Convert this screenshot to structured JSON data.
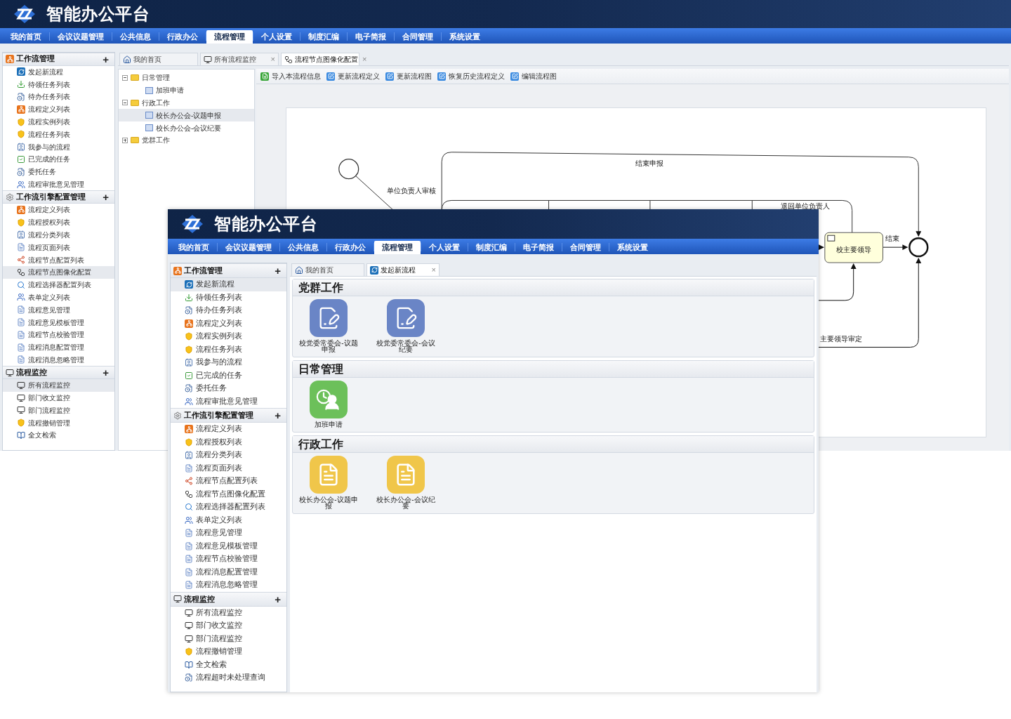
{
  "back_window": {
    "app_title": "智能办公平台",
    "nav": [
      {
        "label": "我的首页",
        "selected": false
      },
      {
        "label": "会议议题管理",
        "selected": false
      },
      {
        "label": "公共信息",
        "selected": false
      },
      {
        "label": "行政办公",
        "selected": false
      },
      {
        "label": "流程管理",
        "selected": true
      },
      {
        "label": "个人设置",
        "selected": false
      },
      {
        "label": "制度汇编",
        "selected": false
      },
      {
        "label": "电子简报",
        "selected": false
      },
      {
        "label": "合同管理",
        "selected": false
      },
      {
        "label": "系统设置",
        "selected": false
      }
    ],
    "sidebar": [
      {
        "title": "工作流管理",
        "kind": "org",
        "toggle": "+",
        "items": [
          {
            "label": "发起新流程",
            "kind": "launch",
            "selected": false
          },
          {
            "label": "待领任务列表",
            "kind": "download",
            "selected": false
          },
          {
            "label": "待办任务列表",
            "kind": "clock-doc",
            "selected": false
          },
          {
            "label": "流程定义列表",
            "kind": "org",
            "selected": false
          },
          {
            "label": "流程实例列表",
            "kind": "shield",
            "selected": false
          },
          {
            "label": "流程任务列表",
            "kind": "shield",
            "selected": false
          },
          {
            "label": "我参与的流程",
            "kind": "people-doc",
            "selected": false
          },
          {
            "label": "已完成的任务",
            "kind": "check",
            "selected": false
          },
          {
            "label": "委托任务",
            "kind": "clock-doc",
            "selected": false
          },
          {
            "label": "流程审批意见管理",
            "kind": "users",
            "selected": false
          }
        ]
      },
      {
        "title": "工作流引擎配置管理",
        "kind": "gear",
        "toggle": "+",
        "items": [
          {
            "label": "流程定义列表",
            "kind": "org",
            "selected": false
          },
          {
            "label": "流程授权列表",
            "kind": "shield",
            "selected": false
          },
          {
            "label": "流程分类列表",
            "kind": "people-doc",
            "selected": false
          },
          {
            "label": "流程页面列表",
            "kind": "page",
            "selected": false
          },
          {
            "label": "流程节点配置列表",
            "kind": "nodes",
            "selected": false
          },
          {
            "label": "流程节点图像化配置",
            "kind": "graph",
            "selected": true
          },
          {
            "label": "流程选择器配置列表",
            "kind": "search",
            "selected": false
          },
          {
            "label": "表单定义列表",
            "kind": "users",
            "selected": false
          },
          {
            "label": "流程意见管理",
            "kind": "page",
            "selected": false
          },
          {
            "label": "流程意见模板管理",
            "kind": "page",
            "selected": false
          },
          {
            "label": "流程节点校验管理",
            "kind": "page",
            "selected": false
          },
          {
            "label": "流程消息配置管理",
            "kind": "page",
            "selected": false
          },
          {
            "label": "流程消息忽略管理",
            "kind": "page",
            "selected": false
          }
        ]
      },
      {
        "title": "流程监控",
        "kind": "monitor",
        "toggle": "+",
        "items": [
          {
            "label": "所有流程监控",
            "kind": "monitor",
            "selected": true
          },
          {
            "label": "部门收文监控",
            "kind": "monitor",
            "selected": false
          },
          {
            "label": "部门流程监控",
            "kind": "monitor",
            "selected": false
          },
          {
            "label": "流程撤销管理",
            "kind": "shield",
            "selected": false
          },
          {
            "label": "全文检索",
            "kind": "book",
            "selected": false
          }
        ]
      }
    ],
    "kind": "diagram",
    "tabs": [
      {
        "label": "我的首页",
        "kind": "home",
        "selected": false
      },
      {
        "label": "所有流程监控",
        "kind": "monitor",
        "close": "×",
        "selected": false
      },
      {
        "label": "流程节点图像化配置",
        "kind": "graph",
        "close": "×",
        "selected": true
      }
    ],
    "tree": [
      {
        "label": "日常管理",
        "expanded": true,
        "children": [
          {
            "label": "加班申请",
            "selected": false
          }
        ]
      },
      {
        "label": "行政工作",
        "expanded": true,
        "children": [
          {
            "label": "校长办公会-议题申报",
            "selected": true
          },
          {
            "label": "校长办公会-会议纪要",
            "selected": false
          }
        ]
      },
      {
        "label": "党群工作",
        "expanded": false
      }
    ],
    "toolbar": [
      {
        "label": "导入本流程信息",
        "kind": "import"
      },
      {
        "label": "更新流程定义",
        "kind": "edit"
      },
      {
        "label": "更新流程图",
        "kind": "edit"
      },
      {
        "label": "恢复历史流程定义",
        "kind": "edit"
      },
      {
        "label": "编辑流程图",
        "kind": "edit"
      }
    ],
    "diagram": {
      "task_label": "校主要领导",
      "edge_labels": [
        "单位负责人审核",
        "结束申报",
        "退回单位负责人",
        "结束",
        "主要领导审定"
      ]
    }
  },
  "front_window": {
    "app_title": "智能办公平台",
    "nav": [
      {
        "label": "我的首页",
        "selected": false
      },
      {
        "label": "会议议题管理",
        "selected": false
      },
      {
        "label": "公共信息",
        "selected": false
      },
      {
        "label": "行政办公",
        "selected": false
      },
      {
        "label": "流程管理",
        "selected": true
      },
      {
        "label": "个人设置",
        "selected": false
      },
      {
        "label": "制度汇编",
        "selected": false
      },
      {
        "label": "电子简报",
        "selected": false
      },
      {
        "label": "合同管理",
        "selected": false
      },
      {
        "label": "系统设置",
        "selected": false
      }
    ],
    "sidebar": [
      {
        "title": "工作流管理",
        "kind": "org",
        "toggle": "+",
        "items": [
          {
            "label": "发起新流程",
            "kind": "launch",
            "selected": true
          },
          {
            "label": "待领任务列表",
            "kind": "download",
            "selected": false
          },
          {
            "label": "待办任务列表",
            "kind": "clock-doc",
            "selected": false
          },
          {
            "label": "流程定义列表",
            "kind": "org",
            "selected": false
          },
          {
            "label": "流程实例列表",
            "kind": "shield",
            "selected": false
          },
          {
            "label": "流程任务列表",
            "kind": "shield",
            "selected": false
          },
          {
            "label": "我参与的流程",
            "kind": "people-doc",
            "selected": false
          },
          {
            "label": "已完成的任务",
            "kind": "check",
            "selected": false
          },
          {
            "label": "委托任务",
            "kind": "clock-doc",
            "selected": false
          },
          {
            "label": "流程审批意见管理",
            "kind": "users",
            "selected": false
          }
        ]
      },
      {
        "title": "工作流引擎配置管理",
        "kind": "gear",
        "toggle": "+",
        "items": [
          {
            "label": "流程定义列表",
            "kind": "org",
            "selected": false
          },
          {
            "label": "流程授权列表",
            "kind": "shield",
            "selected": false
          },
          {
            "label": "流程分类列表",
            "kind": "people-doc",
            "selected": false
          },
          {
            "label": "流程页面列表",
            "kind": "page",
            "selected": false
          },
          {
            "label": "流程节点配置列表",
            "kind": "nodes",
            "selected": false
          },
          {
            "label": "流程节点图像化配置",
            "kind": "graph",
            "selected": false
          },
          {
            "label": "流程选择器配置列表",
            "kind": "search",
            "selected": false
          },
          {
            "label": "表单定义列表",
            "kind": "users",
            "selected": false
          },
          {
            "label": "流程意见管理",
            "kind": "page",
            "selected": false
          },
          {
            "label": "流程意见模板管理",
            "kind": "page",
            "selected": false
          },
          {
            "label": "流程节点校验管理",
            "kind": "page",
            "selected": false
          },
          {
            "label": "流程消息配置管理",
            "kind": "page",
            "selected": false
          },
          {
            "label": "流程消息忽略管理",
            "kind": "page",
            "selected": false
          }
        ]
      },
      {
        "title": "流程监控",
        "kind": "monitor",
        "toggle": "+",
        "items": [
          {
            "label": "所有流程监控",
            "kind": "monitor",
            "selected": false
          },
          {
            "label": "部门收文监控",
            "kind": "monitor",
            "selected": false
          },
          {
            "label": "部门流程监控",
            "kind": "monitor",
            "selected": false
          },
          {
            "label": "流程撤销管理",
            "kind": "shield",
            "selected": false
          },
          {
            "label": "全文检索",
            "kind": "book",
            "selected": false
          },
          {
            "label": "流程超时未处理查询",
            "kind": "clock-doc",
            "selected": false
          }
        ]
      }
    ],
    "kind": "launcher",
    "tabs": [
      {
        "label": "我的首页",
        "kind": "home",
        "selected": false
      },
      {
        "label": "发起新流程",
        "kind": "launch",
        "close": "×",
        "selected": true
      }
    ],
    "categories": [
      {
        "title": "党群工作",
        "items": [
          {
            "label": "校党委常委会-议题申报",
            "kind": "doc-edit",
            "color": "#6a85c6"
          },
          {
            "label": "校党委常委会-会议纪要",
            "kind": "doc-edit",
            "color": "#6a85c6"
          }
        ]
      },
      {
        "title": "日常管理",
        "items": [
          {
            "label": "加班申请",
            "kind": "overtime",
            "color": "#6cc05a"
          }
        ]
      },
      {
        "title": "行政工作",
        "items": [
          {
            "label": "校长办公会-议题申报",
            "kind": "doc-lines",
            "color": "#f0c64a"
          },
          {
            "label": "校长办公会-会议纪要",
            "kind": "doc-lines",
            "color": "#f0c64a"
          }
        ]
      }
    ]
  }
}
